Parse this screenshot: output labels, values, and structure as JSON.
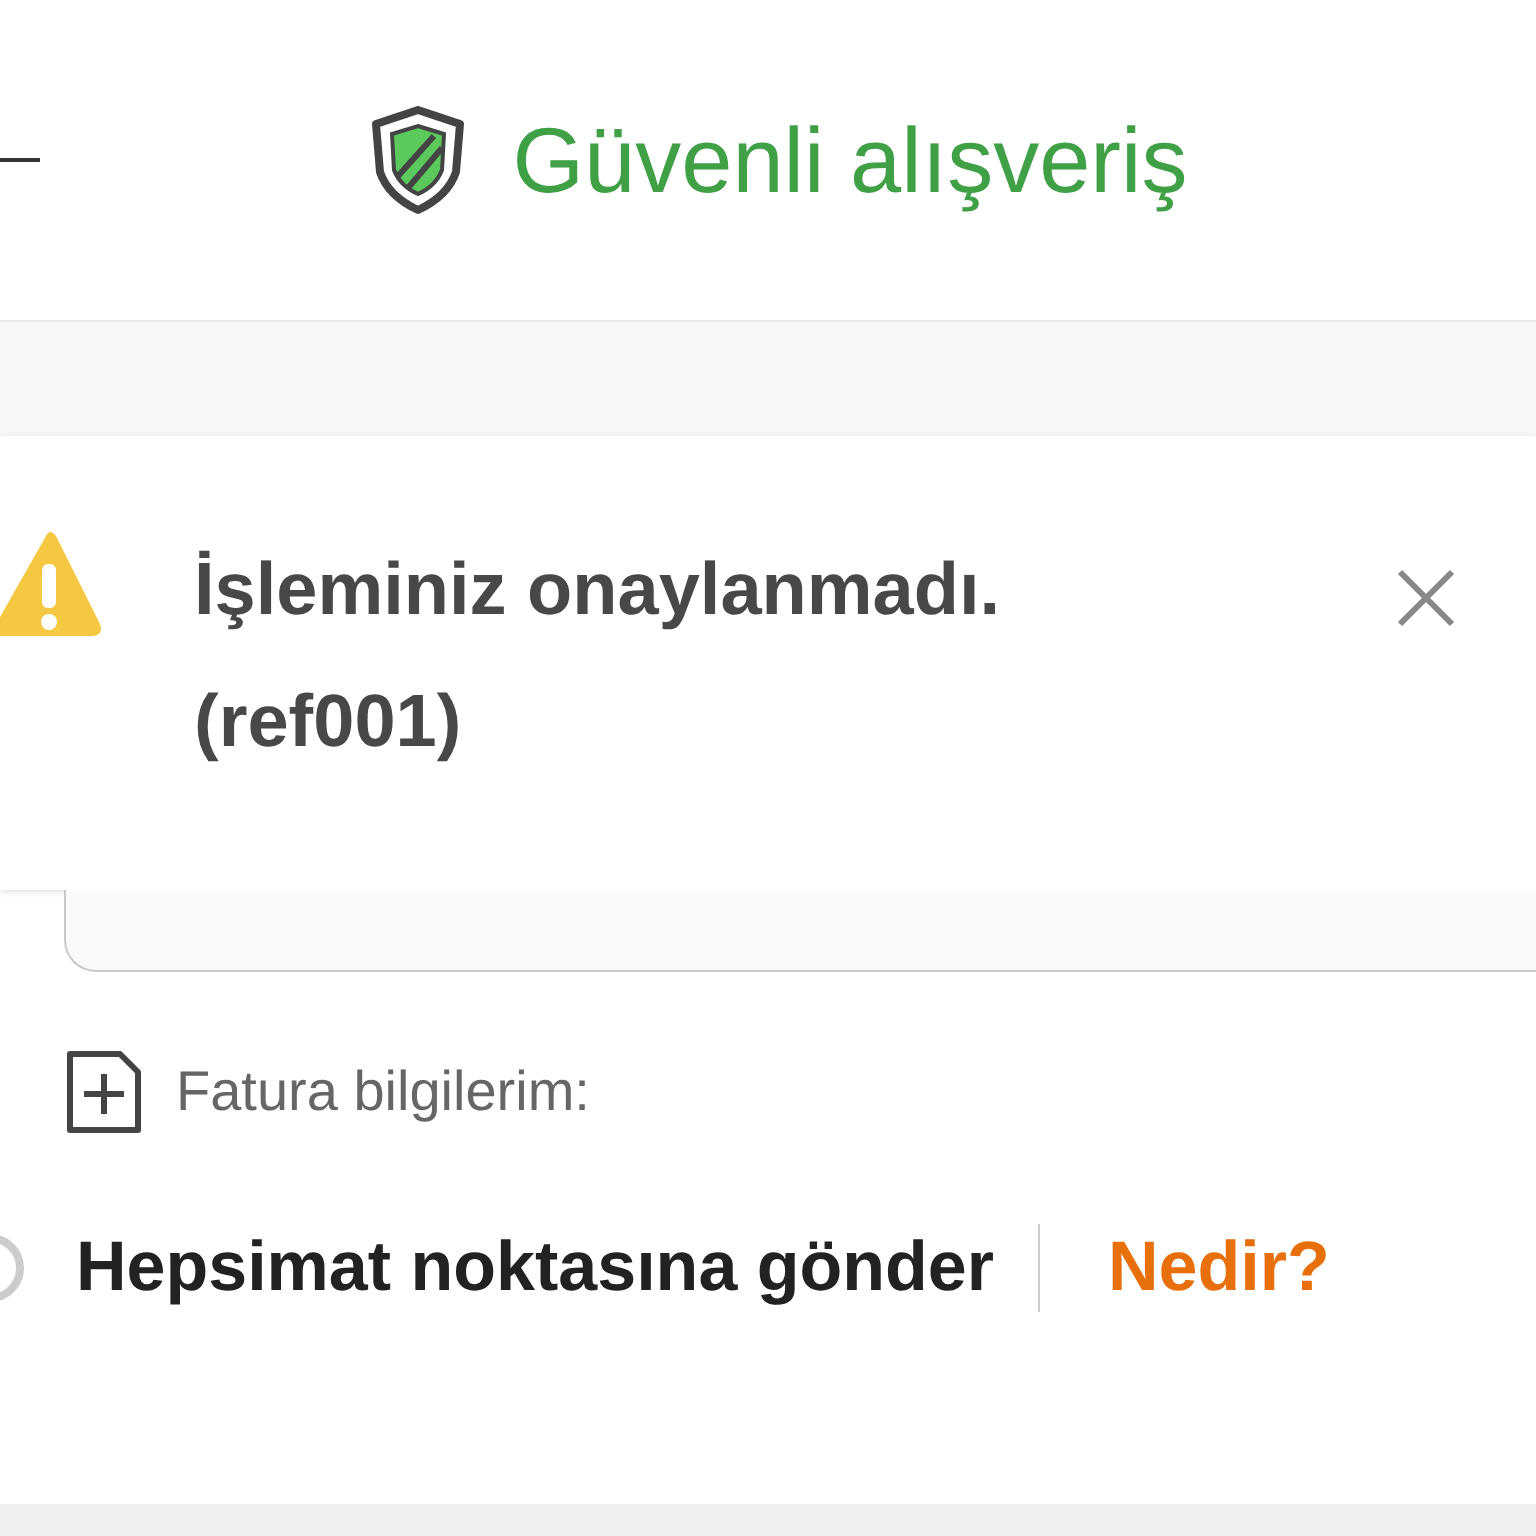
{
  "header": {
    "title": "Güvenli alışveriş"
  },
  "alert": {
    "kind": "warning",
    "message": "İşleminiz onaylanmadı.",
    "reference": "(ref001)"
  },
  "invoice": {
    "label": "Fatura bilgilerim:"
  },
  "delivery_option": {
    "label": "Hepsimat noktasına gönder",
    "selected": false,
    "link": "Nedir?"
  }
}
